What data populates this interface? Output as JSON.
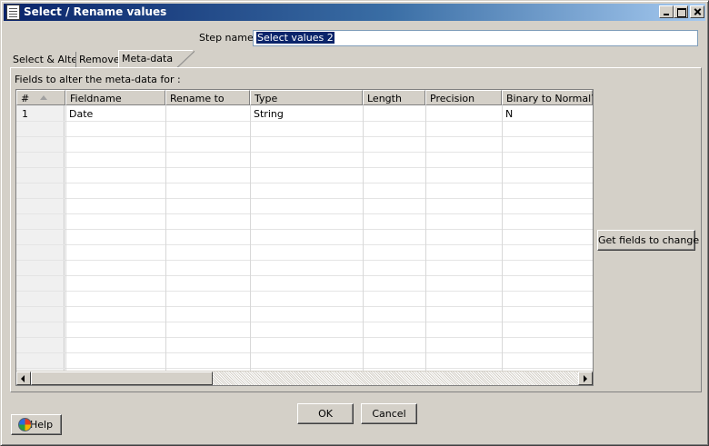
{
  "window": {
    "title": "Select / Rename values"
  },
  "form": {
    "step_name_label": "Step name",
    "step_name_value": "Select values 2"
  },
  "tabs": [
    {
      "label": "Select & Alter",
      "active": false
    },
    {
      "label": "Remove",
      "active": false
    },
    {
      "label": "Meta-data",
      "active": true
    }
  ],
  "meta": {
    "fields_label": "Fields to alter the meta-data for :",
    "columns": [
      "#",
      "Fieldname",
      "Rename to",
      "Type",
      "Length",
      "Precision",
      "Binary to Normal?"
    ],
    "rows": [
      {
        "num": "1",
        "fieldname": "Date",
        "rename_to": "",
        "type": "String",
        "length": "",
        "precision": "",
        "binary_to_normal": "N"
      }
    ],
    "get_fields_label": "Get fields to change"
  },
  "footer": {
    "ok_label": "OK",
    "cancel_label": "Cancel",
    "help_label": "Help"
  },
  "colors": {
    "title_gradient_start": "#0a246a",
    "title_gradient_end": "#a6caf0",
    "face": "#d4d0c8",
    "selection": "#0a246a"
  },
  "icons": [
    "app-icon",
    "minimize-icon",
    "maximize-icon",
    "close-icon",
    "sort-ascending-icon",
    "scroll-left-icon",
    "scroll-right-icon",
    "help-icon"
  ]
}
